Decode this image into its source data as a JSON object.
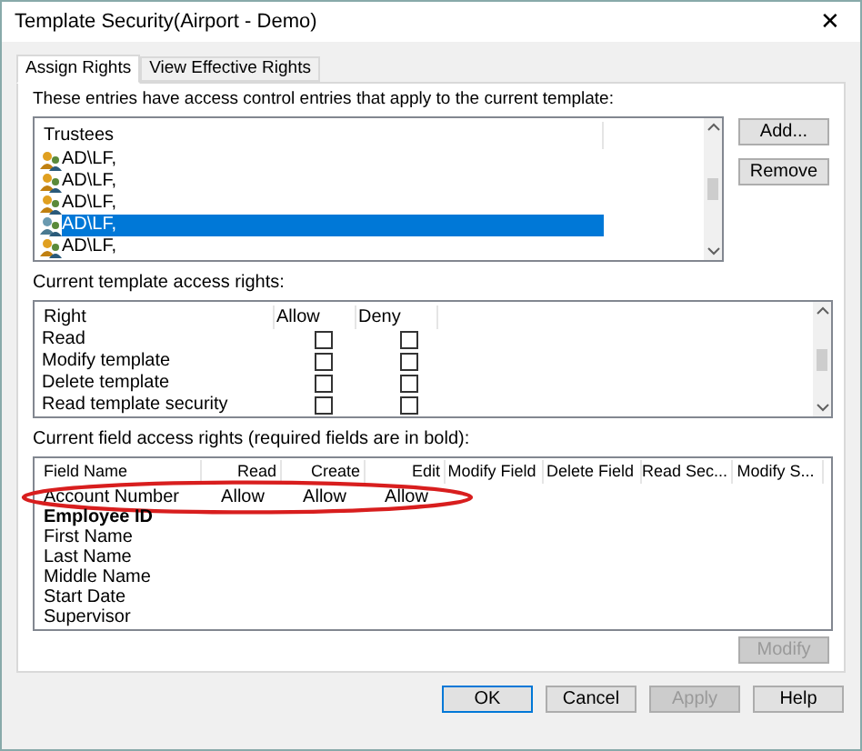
{
  "window": {
    "title": "Template Security(Airport - Demo)",
    "close": "✕"
  },
  "tabs": [
    {
      "label": "Assign Rights",
      "selected": true
    },
    {
      "label": "View Effective Rights",
      "selected": false
    }
  ],
  "trustees": {
    "caption": "These entries have access control entries that apply to the current template:",
    "column": "Trustees",
    "items": [
      {
        "label": "AD\\LF,",
        "selected": false
      },
      {
        "label": "AD\\LF,",
        "selected": false
      },
      {
        "label": "AD\\LF,",
        "selected": false
      },
      {
        "label": "AD\\LF,",
        "selected": true
      },
      {
        "label": "AD\\LF,",
        "selected": false
      }
    ],
    "buttons": [
      {
        "label": "Add...",
        "disabled": false
      },
      {
        "label": "Remove",
        "disabled": false
      }
    ]
  },
  "template_rights": {
    "caption": "Current template access rights:",
    "columns": [
      "Right",
      "Allow",
      "Deny"
    ],
    "rows": [
      {
        "right": "Read",
        "allow": false,
        "deny": false
      },
      {
        "right": "Modify template",
        "allow": false,
        "deny": false
      },
      {
        "right": "Delete template",
        "allow": false,
        "deny": false
      },
      {
        "right": "Read template security",
        "allow": false,
        "deny": false
      }
    ]
  },
  "field_rights": {
    "caption": "Current field access rights (required fields are in bold):",
    "columns": [
      "Field Name",
      "Read",
      "Create",
      "Edit",
      "Modify Field",
      "Delete Field",
      "Read Sec...",
      "Modify S..."
    ],
    "rows": [
      {
        "cells": [
          "Account Number",
          "Allow",
          "Allow",
          "Allow"
        ],
        "required": false,
        "highlighted": true
      },
      {
        "cells": [
          "Employee ID"
        ],
        "required": true,
        "highlighted": false
      },
      {
        "cells": [
          "First Name"
        ],
        "required": false,
        "highlighted": false
      },
      {
        "cells": [
          "Last Name"
        ],
        "required": false,
        "highlighted": false
      },
      {
        "cells": [
          "Middle Name"
        ],
        "required": false,
        "highlighted": false
      },
      {
        "cells": [
          "Start Date"
        ],
        "required": false,
        "highlighted": false
      },
      {
        "cells": [
          "Supervisor"
        ],
        "required": false,
        "highlighted": false
      }
    ],
    "button": {
      "label": "Modify",
      "disabled": true
    }
  },
  "buttons": [
    {
      "label": "OK",
      "disabled": false,
      "default": true
    },
    {
      "label": "Cancel",
      "disabled": false,
      "default": false
    },
    {
      "label": "Apply",
      "disabled": true,
      "default": false
    },
    {
      "label": "Help",
      "disabled": false,
      "default": false
    }
  ]
}
